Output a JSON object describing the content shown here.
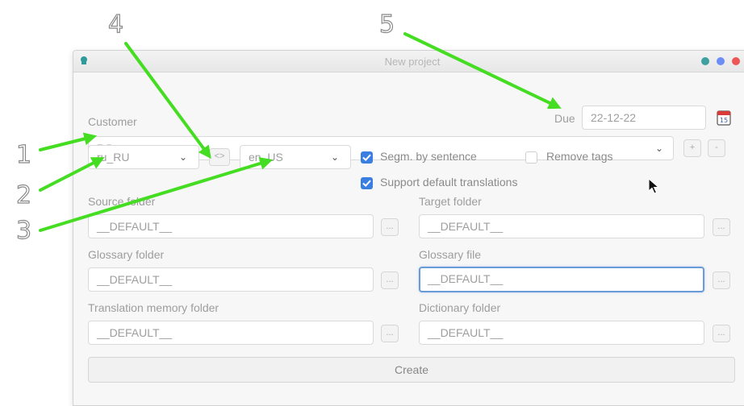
{
  "annotations": {
    "n1": "1",
    "n2": "2",
    "n3": "3",
    "n4": "4",
    "n5": "5",
    "arrow_color": "#44dd22"
  },
  "window": {
    "title": "New project",
    "dot_colors": [
      "#3fa0a0",
      "#6d8cf5",
      "#ee5555"
    ]
  },
  "form": {
    "customer_label": "Customer",
    "customer_value": "7 Days",
    "due_label": "Due",
    "due_value": "22-12-22",
    "calendar_day": "15",
    "add_label": "+",
    "remove_label": "-",
    "source_lang": "ru_RU",
    "swap_label": "<>",
    "target_lang": "en_US",
    "segm_label": "Segm. by sentence",
    "segm_checked": true,
    "remove_tags_label": "Remove tags",
    "remove_tags_checked": false,
    "support_default_label": "Support default translations",
    "support_default_checked": true,
    "source_folder_label": "Source folder",
    "source_folder_value": "__DEFAULT__",
    "target_folder_label": "Target folder",
    "target_folder_value": "__DEFAULT__",
    "glossary_folder_label": "Glossary folder",
    "glossary_folder_value": "__DEFAULT__",
    "glossary_file_label": "Glossary file",
    "glossary_file_value": "__DEFAULT__",
    "tm_folder_label": "Translation memory folder",
    "tm_folder_value": "__DEFAULT__",
    "dictionary_folder_label": "Dictionary folder",
    "dictionary_folder_value": "__DEFAULT__",
    "browse_label": "...",
    "create_label": "Create"
  },
  "icons": {
    "dropdown": "chevron-down-icon",
    "calendar": "calendar-icon",
    "app": "app-icon",
    "cursor": "mouse-cursor-icon"
  }
}
